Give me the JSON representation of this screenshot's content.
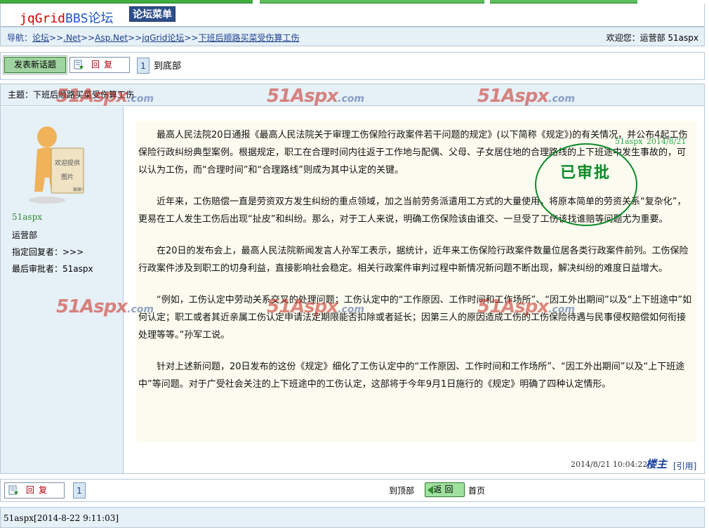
{
  "header": {
    "logo_part1": "jqGrid",
    "logo_part2": "BBS论坛",
    "menu_label": "论坛菜单"
  },
  "nav": {
    "prefix": "导航：",
    "crumbs": [
      "论坛",
      ".Net",
      "Asp.Net",
      "jqGrid论坛",
      "下班后顺路买菜受伤算工伤"
    ],
    "sep": ">>",
    "welcome": "欢迎您：运营部 51aspx"
  },
  "toolbar": {
    "new_topic_label": "发表新话题",
    "reply_label": "回复",
    "page_number": "1",
    "to_bottom": "到底部"
  },
  "post": {
    "subject": "主题：下班后顺路买菜受伤算工伤",
    "user": {
      "name": "51aspx",
      "dept": "运营部",
      "assigned_reply": "指定回复者：>>>",
      "last_approver": "最后审批者：51aspx",
      "avatar_text_line1": "欢迎提供",
      "avatar_text_line2": "图片",
      "avatar_text_line3": "谢谢!"
    },
    "paragraphs": [
      "最高人民法院20日通报《最高人民法院关于审理工伤保险行政案件若干问题的规定》(以下简称《规定》)的有关情况，并公布4起工伤保险行政纠纷典型案例。根据规定，职工在合理时间内往返于工作地与配偶、父母、子女居住地的合理路线的上下班途中发生事故的，可以认为工伤，而“合理时间”和“合理路线”则成为其中认定的关键。",
      "近年来，工伤赔偿一直是劳资双方发生纠纷的重点领域，加之当前劳务派遣用工方式的大量使用，将原本简单的劳资关系“复杂化”，更易在工人发生工伤后出现“扯皮”和纠纷。那么，对于工人来说，明确工伤保险该由谁交、一旦受了工伤该找谁赔等问题尤为重要。",
      "在20日的发布会上，最高人民法院新闻发言人孙军工表示，据统计，近年来工伤保险行政案件数量位居各类行政案件前列。工伤保险行政案件涉及到职工的切身利益，直接影响社会稳定。相关行政案件审判过程中新情况新问题不断出现，解决纠纷的难度日益增大。",
      "“例如，工伤认定中劳动关系交叉的处理问题；工伤认定中的“工作原因、工作时间和工作场所”、“因工外出期间”以及“上下班途中”如何认定；职工或者其近亲属工伤认定申请法定期限能否扣除或者延长；因第三人的原因造成工伤的工伤保险待遇与民事侵权赔偿如何衔接处理等等。”孙军工说。",
      "针对上述新问题，20日发布的这份《规定》细化了工伤认定中的“工作原因、工作时间和工作场所”、“因工外出期间”以及“上下班途中”等问题。对于广受社会关注的上下班途中的工伤认定，这部将于今年9月1日施行的《规定》明确了四种认定情形。"
    ],
    "stamp": {
      "text": "已审批",
      "user": "51aspx",
      "date": "2014/8/21"
    },
    "timestamp": "2014/8/21 10:04:22",
    "louzhu": "楼主",
    "quote": "[引用]"
  },
  "watermark": {
    "brand": "51Aspx",
    "domain": ".com"
  },
  "bottom": {
    "reply_label": "回复",
    "page_number": "1",
    "to_top": "到顶部",
    "back_label": "返回",
    "home": "首页"
  },
  "reply_line": "51aspx[2014-8-22 9:11:03]",
  "colors": {
    "accent_green": "#2c8a2c",
    "nav_blue": "#1a3f8a",
    "panel_bg": "#e6f0f7",
    "content_bg": "#fbfbef"
  }
}
